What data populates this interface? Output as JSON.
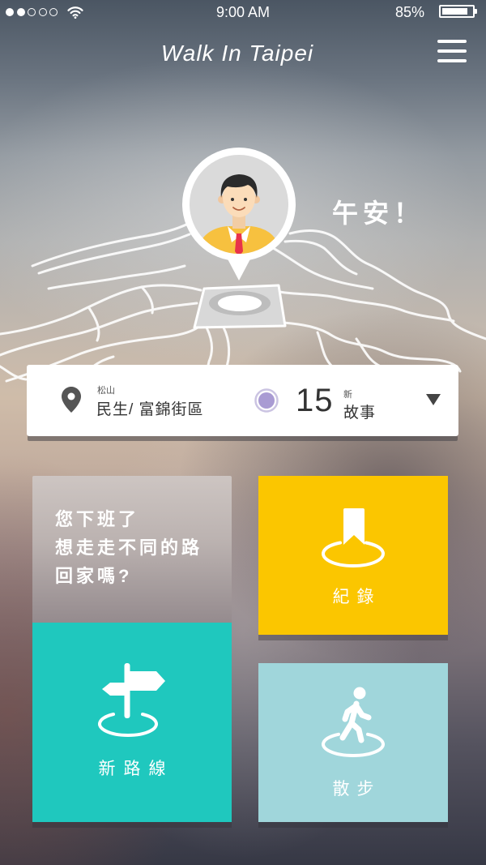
{
  "status_bar": {
    "signal_icon": "signal-dots-icon",
    "signal_level": 2,
    "signal_total": 5,
    "wifi_icon": "wifi-icon",
    "time": "9:00 AM",
    "battery_text": "85%",
    "battery_icon": "battery-icon",
    "battery_level": 0.85
  },
  "header": {
    "title": "Walk In Taipei",
    "menu_icon": "hamburger-menu-icon"
  },
  "hero": {
    "map_icon": "taipei-district-map",
    "avatar_icon": "user-avatar-icon",
    "greeting": "午安！"
  },
  "location_card": {
    "pin_icon": "location-pin-icon",
    "district": "松山",
    "area": "民生/ 富錦街區",
    "story_icon": "purple-dot-icon",
    "story_count": "15",
    "story_new": "新",
    "story_label": "故事",
    "dropdown_icon": "triangle-down-icon"
  },
  "tiles": {
    "prompt": {
      "lines": [
        "您下班了",
        "想走走不同的路",
        "回家嗎?"
      ]
    },
    "new_route": {
      "label": "新路線",
      "icon": "signpost-icon",
      "color": "#1fc8be"
    },
    "record": {
      "label": "紀錄",
      "icon": "bookmark-icon",
      "color": "#fbc600"
    },
    "walk": {
      "label": "散步",
      "icon": "walking-person-icon",
      "color": "#a0d6db"
    }
  }
}
